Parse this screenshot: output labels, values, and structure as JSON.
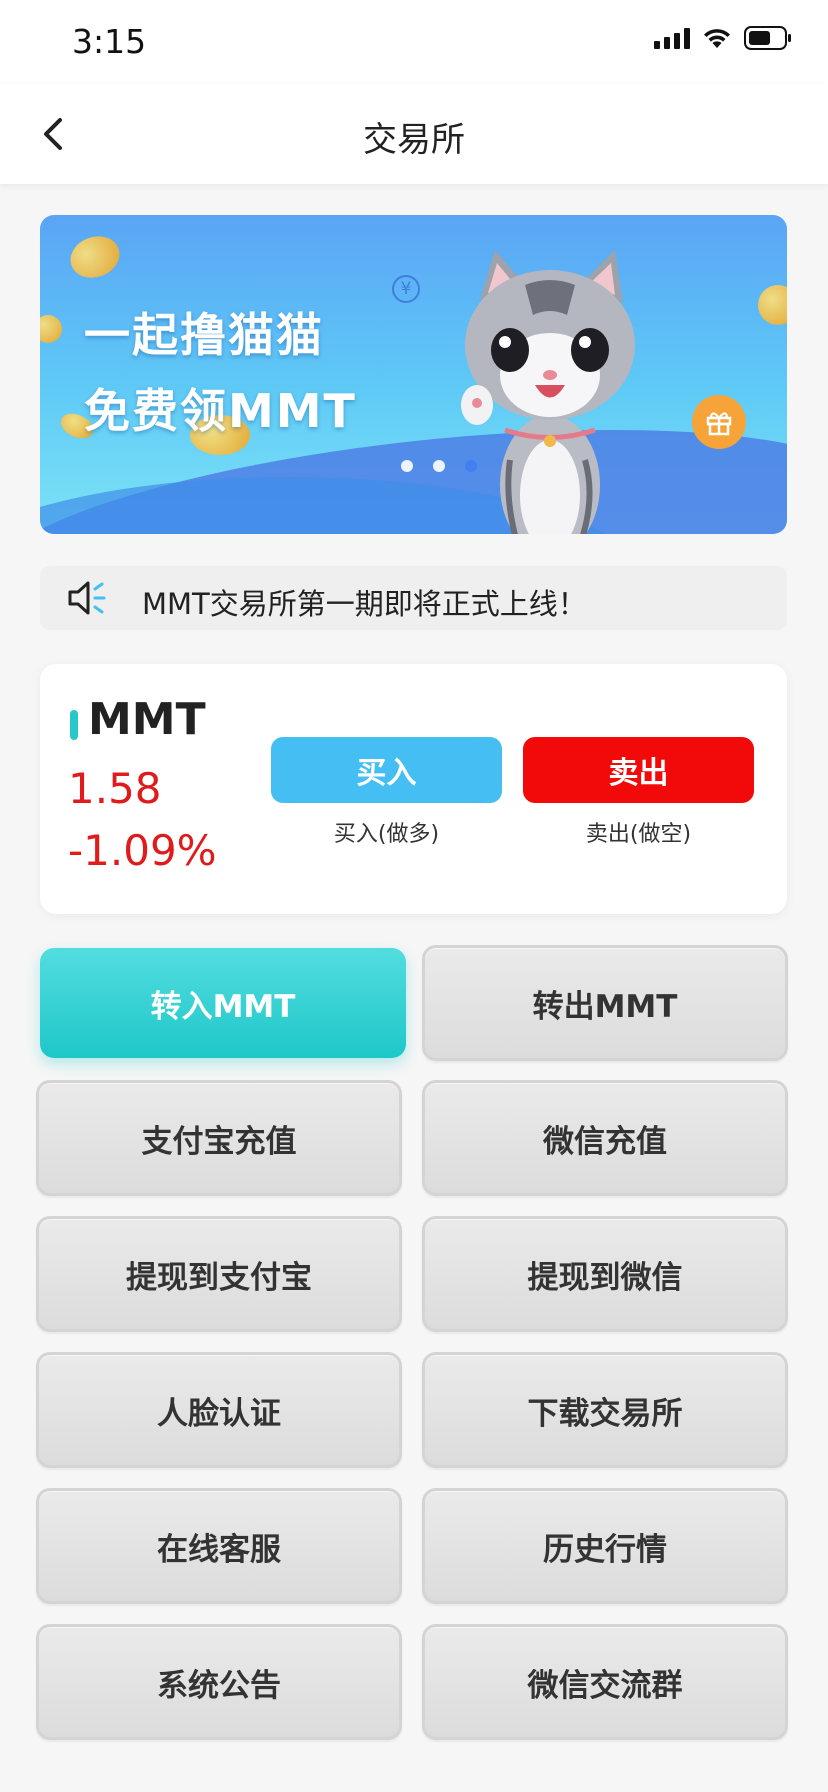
{
  "status_bar": {
    "time": "3:15"
  },
  "nav": {
    "title": "交易所"
  },
  "banner": {
    "line1": "一起撸猫猫",
    "line2": "免费领MMT",
    "dots": 3,
    "active_dot": 3
  },
  "notice": {
    "text": "MMT交易所第一期即将正式上线！"
  },
  "ticker": {
    "symbol": "MMT",
    "price": "1.58",
    "change": "-1.09%",
    "buy_label": "买入",
    "buy_caption": "买入(做多)",
    "sell_label": "卖出",
    "sell_caption": "卖出(做空)"
  },
  "colors": {
    "buy": "#45bff3",
    "sell": "#f20a0a",
    "price_down": "#e01b1b",
    "primary_button": "#1ec7c8"
  },
  "actions": [
    {
      "label": "转入MMT"
    },
    {
      "label": "转出MMT"
    },
    {
      "label": "支付宝充值"
    },
    {
      "label": "微信充值"
    },
    {
      "label": "提现到支付宝"
    },
    {
      "label": "提现到微信"
    },
    {
      "label": "人脸认证"
    },
    {
      "label": "下载交易所"
    },
    {
      "label": "在线客服"
    },
    {
      "label": "历史行情"
    },
    {
      "label": "系统公告"
    },
    {
      "label": "微信交流群"
    }
  ]
}
